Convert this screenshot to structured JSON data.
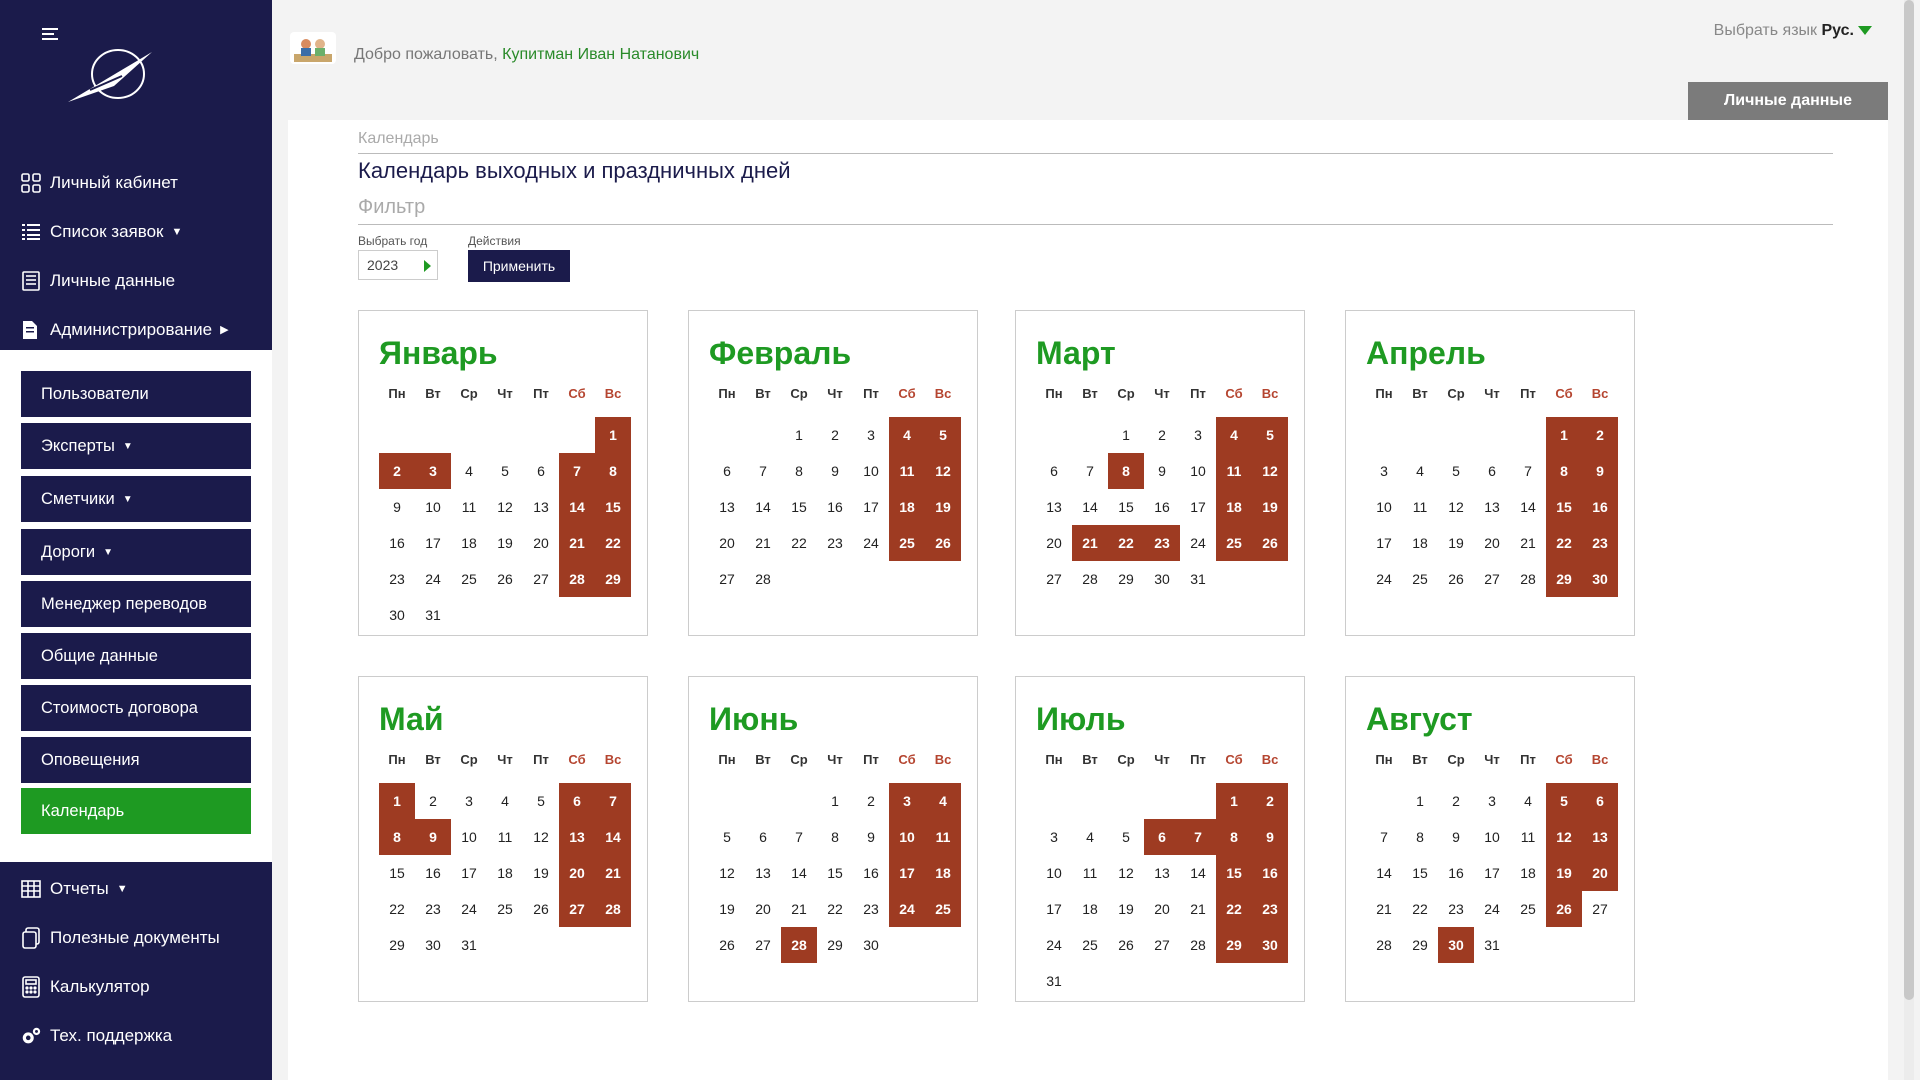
{
  "sidebar": {
    "nav_top": [
      {
        "label": "Личный кабинет",
        "icon": "grid-icon"
      },
      {
        "label": "Список заявок",
        "icon": "list-icon",
        "caret": "▼"
      },
      {
        "label": "Личные данные",
        "icon": "document-icon"
      },
      {
        "label": "Администрирование",
        "icon": "files-icon",
        "caret": "▶"
      }
    ],
    "admin_items": [
      {
        "label": "Пользователи"
      },
      {
        "label": "Эксперты",
        "caret": "▼"
      },
      {
        "label": "Сметчики",
        "caret": "▼"
      },
      {
        "label": "Дороги",
        "caret": "▼"
      },
      {
        "label": "Менеджер переводов"
      },
      {
        "label": "Общие данные"
      },
      {
        "label": "Стоимость договора"
      },
      {
        "label": "Оповещения"
      },
      {
        "label": "Календарь",
        "active": true
      }
    ],
    "nav_bottom": [
      {
        "label": "Отчеты",
        "icon": "table-icon",
        "caret": "▼"
      },
      {
        "label": "Полезные документы",
        "icon": "copy-icon"
      },
      {
        "label": "Калькулятор",
        "icon": "calculator-icon"
      },
      {
        "label": "Тех. поддержка",
        "icon": "gears-icon"
      }
    ]
  },
  "header": {
    "welcome_text": "Добро пожаловать, ",
    "user_name": "Купитман Иван Натанович",
    "lang_label": "Выбрать язык ",
    "lang_value": "Рус.",
    "personal_button": "Личные данные"
  },
  "main": {
    "breadcrumb": "Календарь",
    "title": "Календарь выходных и праздничных дней",
    "filter_title": "Фильтр",
    "year_label": "Выбрать год",
    "year_value": "2023",
    "actions_label": "Действия",
    "apply_button": "Применить"
  },
  "calendar": {
    "weekdays": [
      "Пн",
      "Вт",
      "Ср",
      "Чт",
      "Пт",
      "Сб",
      "Вс"
    ],
    "months": [
      {
        "name": "Январь",
        "start": 6,
        "days": 31,
        "off": [
          1,
          2,
          3,
          7,
          8,
          14,
          15,
          21,
          22,
          28,
          29
        ]
      },
      {
        "name": "Февраль",
        "start": 2,
        "days": 28,
        "off": [
          4,
          5,
          11,
          12,
          18,
          19,
          25,
          26
        ]
      },
      {
        "name": "Март",
        "start": 2,
        "days": 31,
        "off": [
          4,
          5,
          8,
          11,
          12,
          18,
          19,
          21,
          22,
          23,
          25,
          26
        ]
      },
      {
        "name": "Апрель",
        "start": 5,
        "days": 30,
        "off": [
          1,
          2,
          8,
          9,
          15,
          16,
          22,
          23,
          29,
          30
        ]
      },
      {
        "name": "Май",
        "start": 0,
        "days": 31,
        "off": [
          1,
          6,
          7,
          8,
          9,
          13,
          14,
          20,
          21,
          27,
          28
        ]
      },
      {
        "name": "Июнь",
        "start": 3,
        "days": 30,
        "off": [
          3,
          4,
          10,
          11,
          17,
          18,
          24,
          25,
          28
        ]
      },
      {
        "name": "Июль",
        "start": 5,
        "days": 31,
        "off": [
          1,
          2,
          6,
          7,
          8,
          9,
          15,
          16,
          22,
          23,
          29,
          30
        ]
      },
      {
        "name": "Август",
        "start": 1,
        "days": 31,
        "off": [
          5,
          6,
          12,
          13,
          19,
          20,
          26,
          30
        ]
      }
    ]
  }
}
